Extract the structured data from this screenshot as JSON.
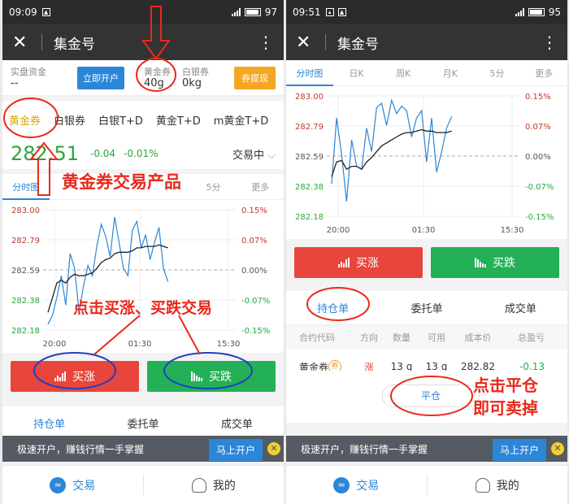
{
  "left": {
    "status": {
      "time": "09:09",
      "battery": "97"
    },
    "app_title": "集金号",
    "account": {
      "funds_label": "实盘资金",
      "funds_value": "--",
      "open_button": "立即开户",
      "gold_ticket_label": "黄金券",
      "gold_ticket_value": "40g",
      "silver_ticket_label": "白银券",
      "silver_ticket_value": "0kg",
      "withdraw_button": "券提现"
    },
    "product_tabs": [
      "黄金券",
      "白银券",
      "白银T+D",
      "黄金T+D",
      "m黄金T+D"
    ],
    "price": "282.51",
    "change": "-0.04",
    "change_pct": "-0.01%",
    "trade_status": "交易中",
    "chart_tabs": [
      "分时图",
      "日K",
      "周K",
      "月K",
      "5分",
      "更多"
    ],
    "buy_up": "买涨",
    "buy_down": "买跌",
    "order_tabs": [
      "持仓单",
      "委托单",
      "成交单"
    ],
    "promo": {
      "text": "极速开户，赚钱行情一手掌握",
      "button": "马上开户"
    },
    "nav": {
      "trade": "交易",
      "mine": "我的"
    },
    "annotations": {
      "product": "黄金券交易产品",
      "click_trade": "点击买涨、买跌交易"
    }
  },
  "right": {
    "status": {
      "time": "09:51",
      "battery": "95"
    },
    "app_title": "集金号",
    "chart_tabs": [
      "分时图",
      "日K",
      "周K",
      "月K",
      "5分",
      "更多"
    ],
    "buy_up": "买涨",
    "buy_down": "买跌",
    "order_tabs": [
      "持仓单",
      "委托单",
      "成交单"
    ],
    "table_headers": [
      "合约代码",
      "方向",
      "数量",
      "可用",
      "成本价",
      "总盈亏"
    ],
    "position": {
      "code": "黄金券",
      "badge": "券",
      "direction": "涨",
      "qty": "13 g",
      "avail": "13 g",
      "cost": "282.82",
      "pnl": "-0.13"
    },
    "close_button": "平仓",
    "promo": {
      "text": "极速开户，赚钱行情一手掌握",
      "button": "马上开户"
    },
    "nav": {
      "trade": "交易",
      "mine": "我的"
    },
    "annotations": {
      "close_line1": "点击平仓",
      "close_line2": "即可卖掉"
    }
  },
  "colors": {
    "accent": "#2c86d8",
    "up": "#e8453c",
    "down": "#23b056",
    "annotation": "#e8291c"
  },
  "chart_data": [
    {
      "type": "line",
      "y_ticks_left": [
        "283.00",
        "282.79",
        "282.59",
        "282.38",
        "282.18"
      ],
      "y_ticks_right": [
        "0.15%",
        "0.07%",
        "0.00%",
        "-0.07%",
        "-0.15%"
      ],
      "x_ticks": [
        "20:00",
        "01:30",
        "15:30"
      ],
      "ylim": [
        282.18,
        283.0
      ],
      "series": [
        {
          "values": [
            282.22,
            282.28,
            282.4,
            282.55,
            282.35,
            282.7,
            282.6,
            282.3,
            282.48,
            282.62,
            282.55,
            282.75,
            282.9,
            282.82,
            282.68,
            282.95,
            282.78,
            282.6,
            282.55,
            282.86,
            282.92,
            282.74,
            282.83,
            282.66,
            282.78,
            282.88,
            282.6,
            282.51
          ]
        },
        {
          "values": [
            282.3,
            282.4,
            282.5,
            282.52,
            282.5,
            282.54,
            282.56,
            282.55,
            282.55,
            282.56,
            282.57,
            282.6,
            282.64,
            282.66,
            282.67,
            282.7,
            282.71,
            282.71,
            282.71,
            282.72,
            282.74,
            282.74,
            282.75,
            282.75,
            282.75,
            282.76,
            282.75,
            282.74
          ]
        }
      ]
    },
    {
      "type": "line",
      "y_ticks_left": [
        "283.00",
        "282.79",
        "282.59",
        "282.38",
        "282.18"
      ],
      "y_ticks_right": [
        "0.15%",
        "0.07%",
        "0.00%",
        "-0.07%",
        "-0.15%"
      ],
      "x_ticks": [
        "20:00",
        "01:30",
        "15:30"
      ],
      "ylim": [
        282.18,
        283.0
      ],
      "series": [
        {
          "values": [
            282.4,
            282.85,
            282.6,
            282.28,
            282.7,
            282.52,
            282.5,
            282.78,
            282.62,
            282.92,
            282.95,
            282.8,
            282.97,
            282.88,
            282.93,
            282.9,
            282.72,
            282.85,
            282.9,
            282.55,
            282.85,
            282.48,
            282.62,
            282.78,
            282.86
          ]
        },
        {
          "values": [
            282.45,
            282.55,
            282.56,
            282.5,
            282.52,
            282.52,
            282.5,
            282.55,
            282.58,
            282.62,
            282.66,
            282.68,
            282.7,
            282.72,
            282.74,
            282.75,
            282.75,
            282.76,
            282.77,
            282.76,
            282.76,
            282.75,
            282.75,
            282.75,
            282.76
          ]
        }
      ]
    }
  ]
}
